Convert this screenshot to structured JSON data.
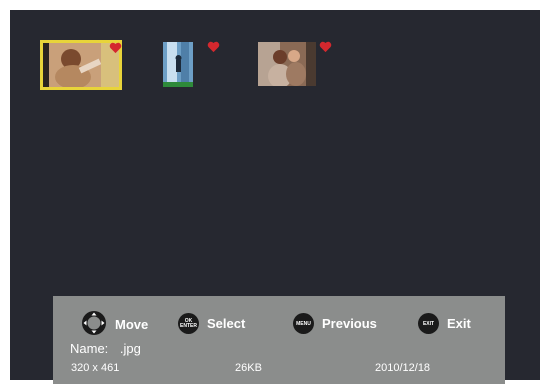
{
  "thumbnails": [
    {
      "id": "photo-1",
      "selected": true,
      "favorite": true
    },
    {
      "id": "photo-2",
      "selected": false,
      "favorite": true
    },
    {
      "id": "photo-3",
      "selected": false,
      "favorite": true
    }
  ],
  "controls": {
    "move": "Move",
    "ok_top": "OK",
    "ok_bottom": "ENTER",
    "select": "Select",
    "menu_icon": "MENU",
    "previous": "Previous",
    "exit_icon": "EXIT",
    "exit": "Exit"
  },
  "file": {
    "name_label": "Name:",
    "name_value": ".jpg",
    "resolution": "320 x 461",
    "size": "26KB",
    "date": "2010/12/18"
  },
  "colors": {
    "background": "#262830",
    "selection": "#e8d43a",
    "heart": "#d4282e",
    "bar": "#8b8d8c"
  }
}
